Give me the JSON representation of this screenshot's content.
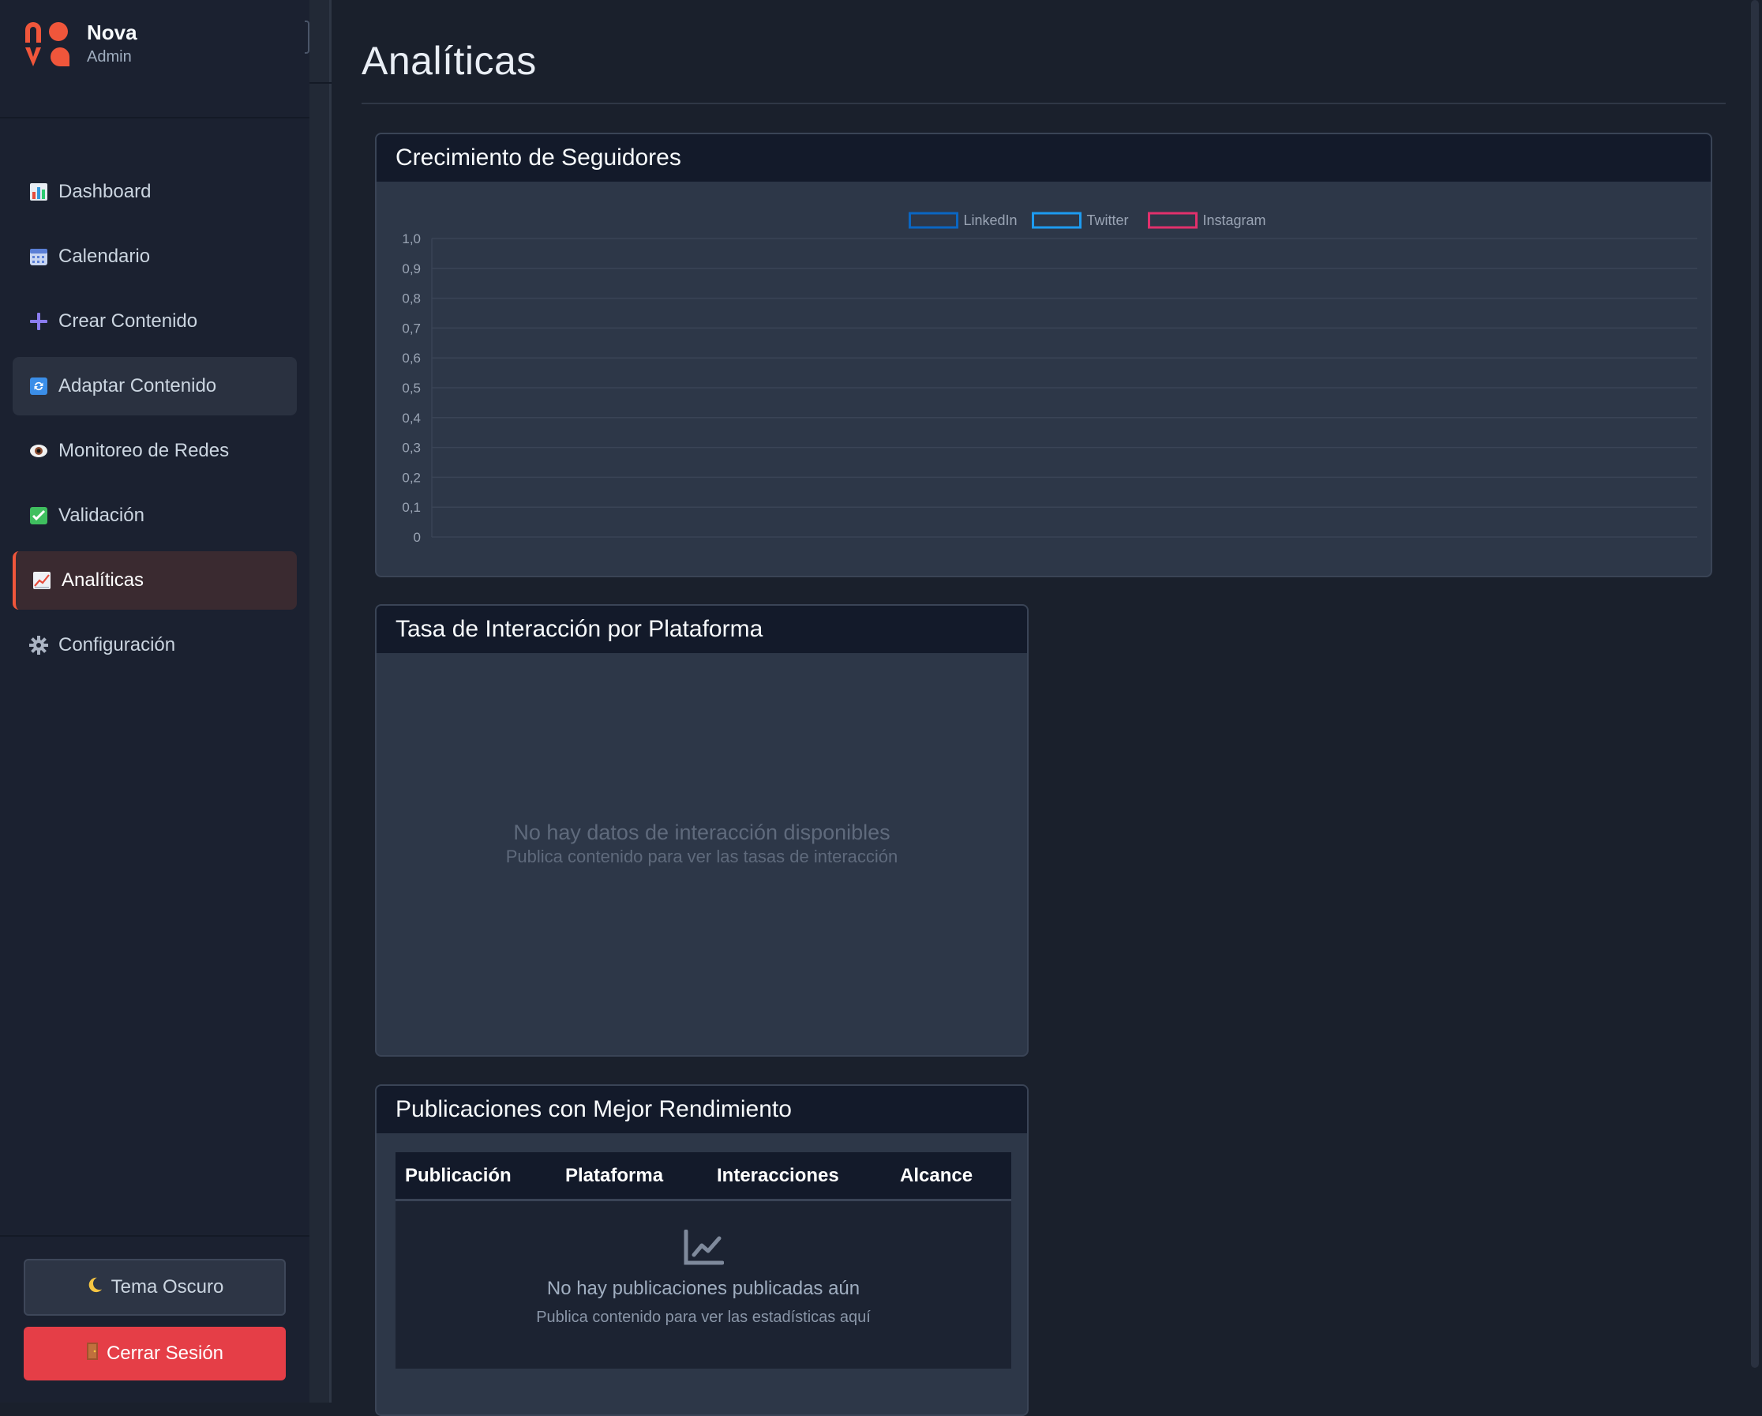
{
  "brand": {
    "name": "Nova",
    "role": "Admin"
  },
  "nav": [
    {
      "label": "Dashboard",
      "icon": "bar-chart-icon"
    },
    {
      "label": "Calendario",
      "icon": "calendar-icon"
    },
    {
      "label": "Crear Contenido",
      "icon": "plus-icon"
    },
    {
      "label": "Adaptar Contenido",
      "icon": "refresh-icon"
    },
    {
      "label": "Monitoreo de Redes",
      "icon": "eye-icon"
    },
    {
      "label": "Validación",
      "icon": "check-icon"
    },
    {
      "label": "Analíticas",
      "icon": "trend-chart-icon"
    },
    {
      "label": "Configuración",
      "icon": "gear-icon"
    }
  ],
  "active_nav": "Analíticas",
  "hovered_nav": "Adaptar Contenido",
  "sidebar_footer": {
    "theme_label": "Tema Oscuro",
    "logout_label": "Cerrar Sesión"
  },
  "page": {
    "title": "Analíticas"
  },
  "followers_card": {
    "title": "Crecimiento de Seguidores"
  },
  "interaction_card": {
    "title": "Tasa de Interacción por Plataforma",
    "empty_title": "No hay datos de interacción disponibles",
    "empty_sub": "Publica contenido para ver las tasas de interacción"
  },
  "posts_card": {
    "title": "Publicaciones con Mejor Rendimiento",
    "columns": [
      "Publicación",
      "Plataforma",
      "Interacciones",
      "Alcance"
    ],
    "empty_title": "No hay publicaciones publicadas aún",
    "empty_sub": "Publica contenido para ver las estadísticas aquí"
  },
  "colors": {
    "accent": "#f0563b",
    "logout": "#e53e47",
    "linkedin": "#0a66c2",
    "twitter": "#1d9bf0",
    "instagram": "#e1306c"
  },
  "chart_data": {
    "type": "line",
    "title": "",
    "xlabel": "",
    "ylabel": "",
    "ylim": [
      0,
      1
    ],
    "y_ticks": [
      "0",
      "0,1",
      "0,2",
      "0,3",
      "0,4",
      "0,5",
      "0,6",
      "0,7",
      "0,8",
      "0,9",
      "1,0"
    ],
    "legend_position": "top-center",
    "categories": [],
    "series": [
      {
        "name": "LinkedIn",
        "color": "#0a66c2",
        "values": []
      },
      {
        "name": "Twitter",
        "color": "#1d9bf0",
        "values": []
      },
      {
        "name": "Instagram",
        "color": "#e1306c",
        "values": []
      }
    ],
    "grid": true
  }
}
